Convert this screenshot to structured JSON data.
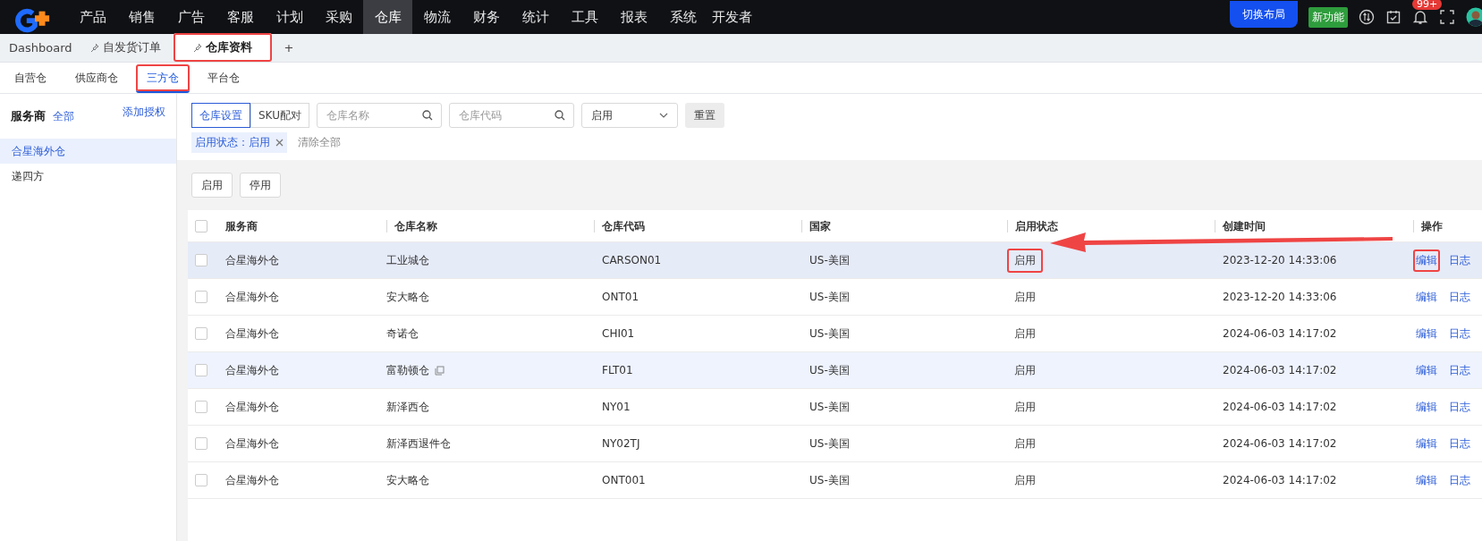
{
  "top_nav": {
    "items": [
      {
        "label": "产品",
        "selected": false
      },
      {
        "label": "销售",
        "selected": false
      },
      {
        "label": "广告",
        "selected": false
      },
      {
        "label": "客服",
        "selected": false
      },
      {
        "label": "计划",
        "selected": false
      },
      {
        "label": "采购",
        "selected": false
      },
      {
        "label": "仓库",
        "selected": true
      },
      {
        "label": "物流",
        "selected": false
      },
      {
        "label": "财务",
        "selected": false
      },
      {
        "label": "统计",
        "selected": false
      },
      {
        "label": "工具",
        "selected": false
      },
      {
        "label": "报表",
        "selected": false
      },
      {
        "label": "系统",
        "selected": false
      },
      {
        "label": "开发者",
        "selected": false
      }
    ],
    "switch_layout": "切换布局",
    "new_feature": "新功能",
    "notification_badge": "99+"
  },
  "page_tabs": [
    {
      "label": "Dashboard",
      "pinned": false,
      "selected": false,
      "highlighted": false
    },
    {
      "label": "自发货订单",
      "pinned": true,
      "selected": false,
      "highlighted": false
    },
    {
      "label": "仓库资料",
      "pinned": true,
      "selected": true,
      "highlighted": true
    },
    {
      "label": "+",
      "pinned": false,
      "selected": false,
      "highlighted": false
    }
  ],
  "sub_tabs": [
    {
      "label": "自营仓",
      "selected": false,
      "highlighted": false
    },
    {
      "label": "供应商仓",
      "selected": false,
      "highlighted": false
    },
    {
      "label": "三方仓",
      "selected": true,
      "highlighted": true
    },
    {
      "label": "平台仓",
      "selected": false,
      "highlighted": false
    }
  ],
  "sidebar": {
    "title": "服务商",
    "all_link": "全部",
    "add_link": "添加授权",
    "items": [
      {
        "label": "合星海外仓",
        "selected": true
      },
      {
        "label": "递四方",
        "selected": false
      }
    ]
  },
  "filters": {
    "mode_tabs": [
      {
        "label": "仓库设置",
        "selected": true
      },
      {
        "label": "SKU配对",
        "selected": false
      }
    ],
    "name_field": {
      "placeholder": "仓库名称"
    },
    "code_field": {
      "placeholder": "仓库代码"
    },
    "status_select": {
      "value": "启用"
    },
    "reset": "重置",
    "active_tags": [
      {
        "label": "启用状态：启用"
      }
    ],
    "clear_all": "清除全部"
  },
  "actions": [
    "启用",
    "停用"
  ],
  "table": {
    "select_all_checked": false,
    "columns": [
      "服务商",
      "仓库名称",
      "仓库代码",
      "国家",
      "启用状态",
      "创建时间",
      "操作"
    ],
    "rows": [
      {
        "provider": "合星海外仓",
        "name": "工业城仓",
        "copy_icon": false,
        "code": "CARSON01",
        "country": "US-美国",
        "status": "启用",
        "status_highlighted": true,
        "created": "2023-12-20 14:33:06",
        "edit": "编辑",
        "edit_highlighted": true,
        "log": "日志",
        "checked": false,
        "selected": true,
        "hovered": false
      },
      {
        "provider": "合星海外仓",
        "name": "安大略仓",
        "copy_icon": false,
        "code": "ONT01",
        "country": "US-美国",
        "status": "启用",
        "status_highlighted": false,
        "created": "2023-12-20 14:33:06",
        "edit": "编辑",
        "edit_highlighted": false,
        "log": "日志",
        "checked": false,
        "selected": false,
        "hovered": false
      },
      {
        "provider": "合星海外仓",
        "name": "奇诺仓",
        "copy_icon": false,
        "code": "CHI01",
        "country": "US-美国",
        "status": "启用",
        "status_highlighted": false,
        "created": "2024-06-03 14:17:02",
        "edit": "编辑",
        "edit_highlighted": false,
        "log": "日志",
        "checked": false,
        "selected": false,
        "hovered": false
      },
      {
        "provider": "合星海外仓",
        "name": "富勒顿仓",
        "copy_icon": true,
        "code": "FLT01",
        "country": "US-美国",
        "status": "启用",
        "status_highlighted": false,
        "created": "2024-06-03 14:17:02",
        "edit": "编辑",
        "edit_highlighted": false,
        "log": "日志",
        "checked": false,
        "selected": false,
        "hovered": true
      },
      {
        "provider": "合星海外仓",
        "name": "新泽西仓",
        "copy_icon": false,
        "code": "NY01",
        "country": "US-美国",
        "status": "启用",
        "status_highlighted": false,
        "created": "2024-06-03 14:17:02",
        "edit": "编辑",
        "edit_highlighted": false,
        "log": "日志",
        "checked": false,
        "selected": false,
        "hovered": false
      },
      {
        "provider": "合星海外仓",
        "name": "新泽西退件仓",
        "copy_icon": false,
        "code": "NY02TJ",
        "country": "US-美国",
        "status": "启用",
        "status_highlighted": false,
        "created": "2024-06-03 14:17:02",
        "edit": "编辑",
        "edit_highlighted": false,
        "log": "日志",
        "checked": false,
        "selected": false,
        "hovered": false
      },
      {
        "provider": "合星海外仓",
        "name": "安大略仓",
        "copy_icon": false,
        "code": "ONT001",
        "country": "US-美国",
        "status": "启用",
        "status_highlighted": false,
        "created": "2024-06-03 14:17:02",
        "edit": "编辑",
        "edit_highlighted": false,
        "log": "日志",
        "checked": false,
        "selected": false,
        "hovered": false
      }
    ]
  }
}
